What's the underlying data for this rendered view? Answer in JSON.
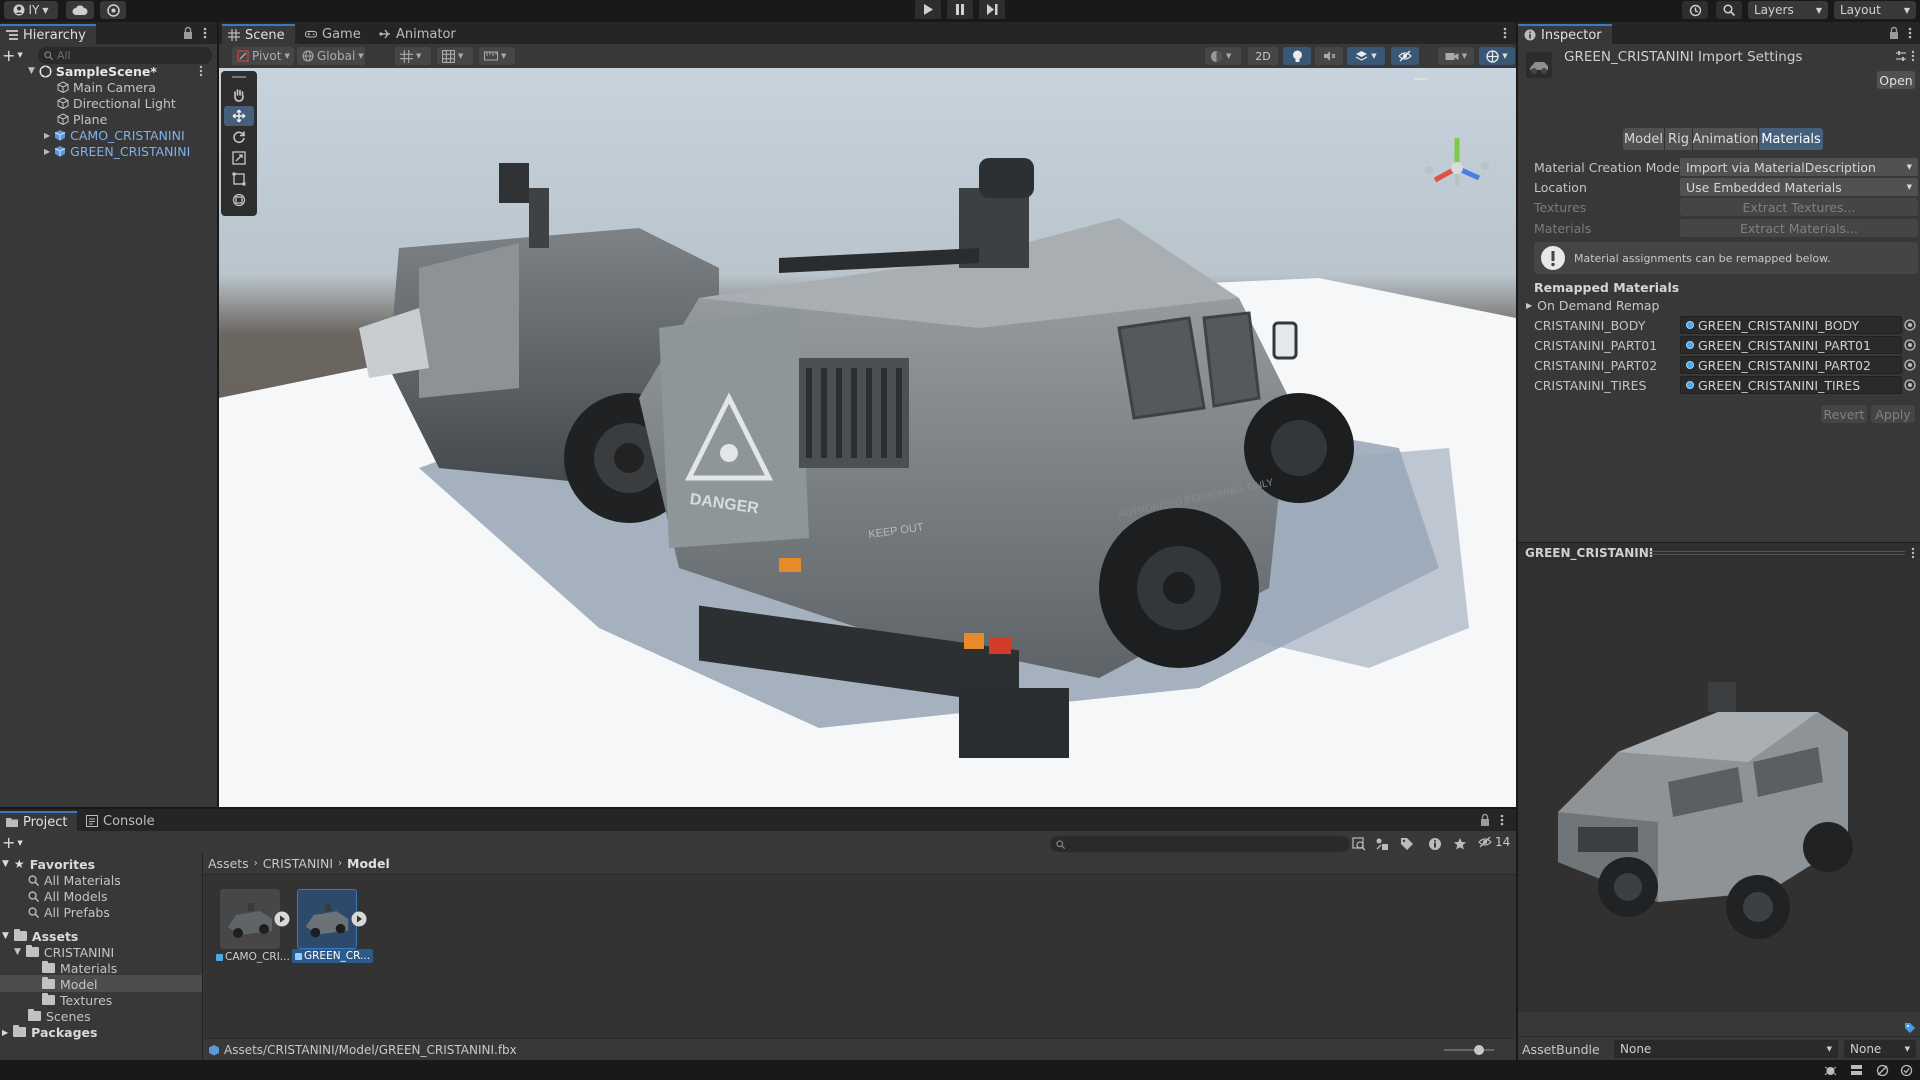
{
  "toolbar": {
    "account_label": "IY",
    "layers_label": "Layers",
    "layout_label": "Layout"
  },
  "hierarchy": {
    "tab_label": "Hierarchy",
    "search_placeholder": "All",
    "scene_name": "SampleScene*",
    "items": [
      {
        "label": "Main Camera",
        "type": "gameobject"
      },
      {
        "label": "Directional Light",
        "type": "gameobject"
      },
      {
        "label": "Plane",
        "type": "gameobject"
      },
      {
        "label": "CAMO_CRISTANINI",
        "type": "prefab"
      },
      {
        "label": "GREEN_CRISTANINI",
        "type": "prefab"
      }
    ]
  },
  "scene_view": {
    "tabs": [
      {
        "label": "Scene",
        "active": true
      },
      {
        "label": "Game",
        "active": false
      },
      {
        "label": "Animator",
        "active": false
      }
    ],
    "pivot_label": "Pivot",
    "global_label": "Global",
    "mode_2d_label": "2D",
    "decal_text": "DANGER",
    "decal_text_2": "KEEP OUT",
    "decal_text_3": "AUTHORIZED PERSONNEL ONLY"
  },
  "inspector": {
    "tab_label": "Inspector",
    "title": "GREEN_CRISTANINI Import Settings",
    "open_button": "Open",
    "tabs": [
      {
        "label": "Model",
        "active": false
      },
      {
        "label": "Rig",
        "active": false
      },
      {
        "label": "Animation",
        "active": false
      },
      {
        "label": "Materials",
        "active": true
      }
    ],
    "material_creation_mode": {
      "label": "Material Creation Mode",
      "value": "Import via MaterialDescription"
    },
    "location": {
      "label": "Location",
      "value": "Use Embedded Materials"
    },
    "textures": {
      "label": "Textures",
      "button": "Extract Textures..."
    },
    "materials": {
      "label": "Materials",
      "button": "Extract Materials..."
    },
    "help_text": "Material assignments can be remapped below.",
    "remapped_header": "Remapped Materials",
    "on_demand_remap": "On Demand Remap",
    "remaps": [
      {
        "source": "CRISTANINI_BODY",
        "target": "GREEN_CRISTANINI_BODY"
      },
      {
        "source": "CRISTANINI_PART01",
        "target": "GREEN_CRISTANINI_PART01"
      },
      {
        "source": "CRISTANINI_PART02",
        "target": "GREEN_CRISTANINI_PART02"
      },
      {
        "source": "CRISTANINI_TIRES",
        "target": "GREEN_CRISTANINI_TIRES"
      }
    ],
    "revert_button": "Revert",
    "apply_button": "Apply",
    "preview_title": "GREEN_CRISTANINI",
    "assetbundle_label": "AssetBundle",
    "assetbundle_value": "None",
    "assetbundle_variant": "None"
  },
  "project": {
    "tabs": [
      {
        "label": "Project",
        "active": true
      },
      {
        "label": "Console",
        "active": false
      }
    ],
    "hidden_count": "14",
    "favorites_label": "Favorites",
    "favorites": [
      "All Materials",
      "All Models",
      "All Prefabs"
    ],
    "assets_label": "Assets",
    "cristanini_label": "CRISTANINI",
    "cristanini_children": [
      "Materials",
      "Model",
      "Textures"
    ],
    "scenes_label": "Scenes",
    "packages_label": "Packages",
    "breadcrumb": [
      "Assets",
      "CRISTANINI",
      "Model"
    ],
    "files": [
      {
        "label": "CAMO_CRI..."
      },
      {
        "label": "GREEN_CR..."
      }
    ],
    "status_path": "Assets/CRISTANINI/Model/GREEN_CRISTANINI.fbx"
  }
}
